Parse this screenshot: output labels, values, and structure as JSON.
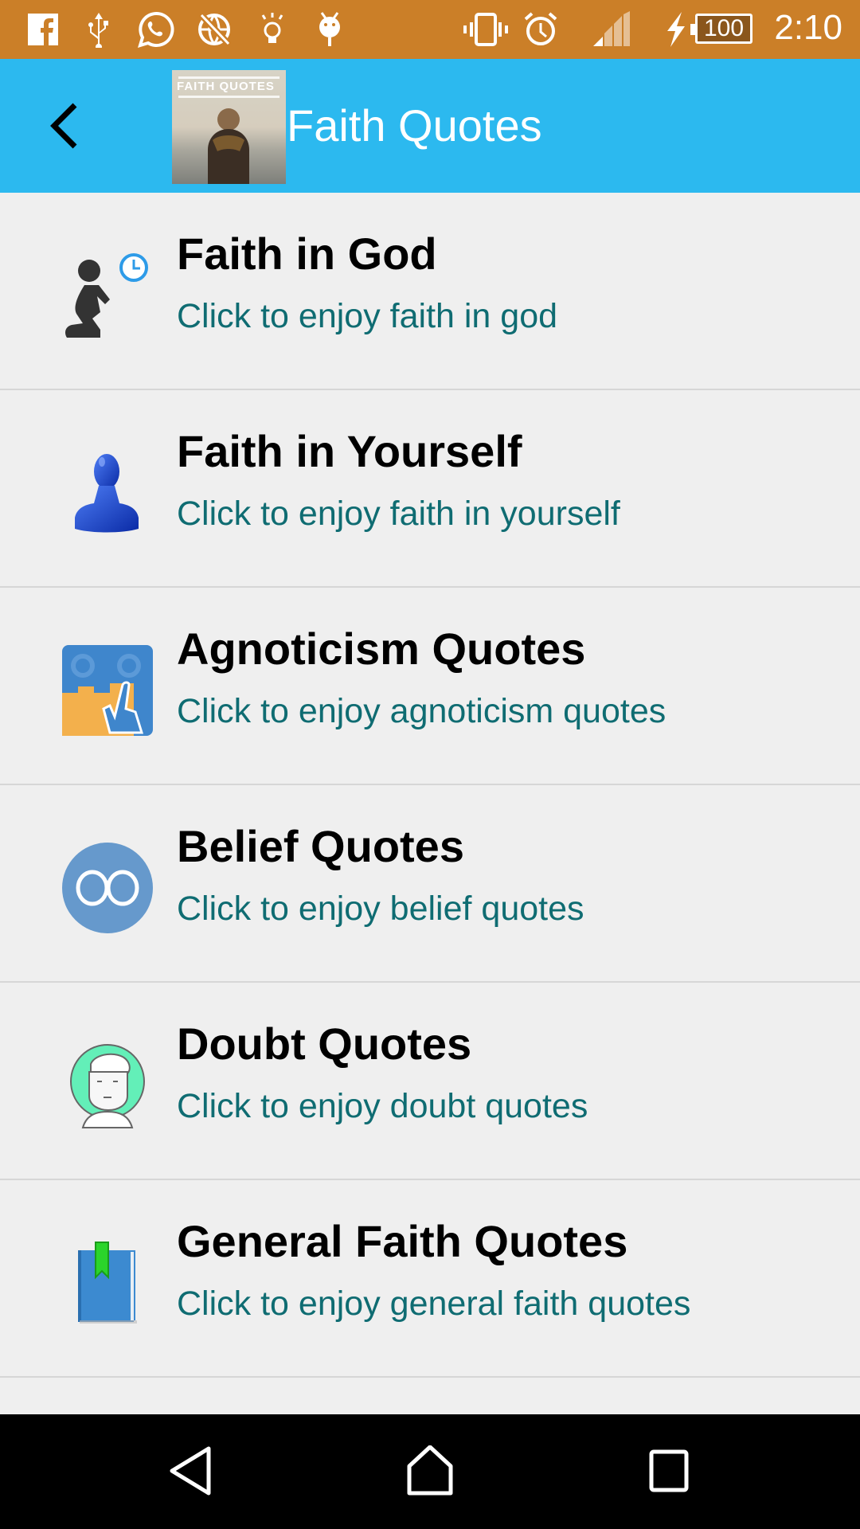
{
  "status_bar": {
    "time": "2:10",
    "battery_level": "100",
    "notification_icons": [
      "facebook-icon",
      "usb-icon",
      "whatsapp-icon",
      "no-network-icon",
      "lightbulb-icon",
      "android-debug-icon"
    ],
    "system_icons": [
      "vibrate-icon",
      "alarm-icon",
      "signal-icon",
      "charging-icon",
      "battery-icon"
    ],
    "background_color": "#cb7f28"
  },
  "app_bar": {
    "title": "Faith Quotes",
    "logo_text": "FAITH QUOTES",
    "background_color": "#2cb9ef"
  },
  "list": {
    "items": [
      {
        "title": "Faith in God",
        "subtitle": "Click to enjoy faith in god",
        "icon": "praying-person-icon"
      },
      {
        "title": "Faith in Yourself",
        "subtitle": "Click to enjoy faith in yourself",
        "icon": "person-bust-icon"
      },
      {
        "title": "Agnoticism Quotes",
        "subtitle": "Click to enjoy agnoticism quotes",
        "icon": "puzzle-hand-icon"
      },
      {
        "title": "Belief Quotes",
        "subtitle": "Click to enjoy belief quotes",
        "icon": "infinity-icon"
      },
      {
        "title": "Doubt Quotes",
        "subtitle": "Click to enjoy doubt quotes",
        "icon": "doubtful-face-icon"
      },
      {
        "title": "General Faith Quotes",
        "subtitle": "Click to enjoy general faith quotes",
        "icon": "book-bookmark-icon"
      }
    ],
    "subtitle_color": "#0f6c72"
  },
  "nav_bar": {
    "buttons": [
      "back",
      "home",
      "recents"
    ]
  }
}
